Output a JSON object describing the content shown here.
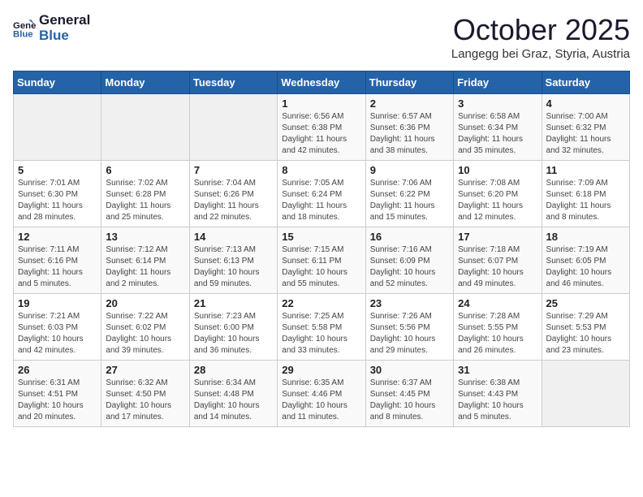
{
  "header": {
    "logo_line1": "General",
    "logo_line2": "Blue",
    "month": "October 2025",
    "location": "Langegg bei Graz, Styria, Austria"
  },
  "weekdays": [
    "Sunday",
    "Monday",
    "Tuesday",
    "Wednesday",
    "Thursday",
    "Friday",
    "Saturday"
  ],
  "weeks": [
    [
      {
        "day": "",
        "info": ""
      },
      {
        "day": "",
        "info": ""
      },
      {
        "day": "",
        "info": ""
      },
      {
        "day": "1",
        "info": "Sunrise: 6:56 AM\nSunset: 6:38 PM\nDaylight: 11 hours\nand 42 minutes."
      },
      {
        "day": "2",
        "info": "Sunrise: 6:57 AM\nSunset: 6:36 PM\nDaylight: 11 hours\nand 38 minutes."
      },
      {
        "day": "3",
        "info": "Sunrise: 6:58 AM\nSunset: 6:34 PM\nDaylight: 11 hours\nand 35 minutes."
      },
      {
        "day": "4",
        "info": "Sunrise: 7:00 AM\nSunset: 6:32 PM\nDaylight: 11 hours\nand 32 minutes."
      }
    ],
    [
      {
        "day": "5",
        "info": "Sunrise: 7:01 AM\nSunset: 6:30 PM\nDaylight: 11 hours\nand 28 minutes."
      },
      {
        "day": "6",
        "info": "Sunrise: 7:02 AM\nSunset: 6:28 PM\nDaylight: 11 hours\nand 25 minutes."
      },
      {
        "day": "7",
        "info": "Sunrise: 7:04 AM\nSunset: 6:26 PM\nDaylight: 11 hours\nand 22 minutes."
      },
      {
        "day": "8",
        "info": "Sunrise: 7:05 AM\nSunset: 6:24 PM\nDaylight: 11 hours\nand 18 minutes."
      },
      {
        "day": "9",
        "info": "Sunrise: 7:06 AM\nSunset: 6:22 PM\nDaylight: 11 hours\nand 15 minutes."
      },
      {
        "day": "10",
        "info": "Sunrise: 7:08 AM\nSunset: 6:20 PM\nDaylight: 11 hours\nand 12 minutes."
      },
      {
        "day": "11",
        "info": "Sunrise: 7:09 AM\nSunset: 6:18 PM\nDaylight: 11 hours\nand 8 minutes."
      }
    ],
    [
      {
        "day": "12",
        "info": "Sunrise: 7:11 AM\nSunset: 6:16 PM\nDaylight: 11 hours\nand 5 minutes."
      },
      {
        "day": "13",
        "info": "Sunrise: 7:12 AM\nSunset: 6:14 PM\nDaylight: 11 hours\nand 2 minutes."
      },
      {
        "day": "14",
        "info": "Sunrise: 7:13 AM\nSunset: 6:13 PM\nDaylight: 10 hours\nand 59 minutes."
      },
      {
        "day": "15",
        "info": "Sunrise: 7:15 AM\nSunset: 6:11 PM\nDaylight: 10 hours\nand 55 minutes."
      },
      {
        "day": "16",
        "info": "Sunrise: 7:16 AM\nSunset: 6:09 PM\nDaylight: 10 hours\nand 52 minutes."
      },
      {
        "day": "17",
        "info": "Sunrise: 7:18 AM\nSunset: 6:07 PM\nDaylight: 10 hours\nand 49 minutes."
      },
      {
        "day": "18",
        "info": "Sunrise: 7:19 AM\nSunset: 6:05 PM\nDaylight: 10 hours\nand 46 minutes."
      }
    ],
    [
      {
        "day": "19",
        "info": "Sunrise: 7:21 AM\nSunset: 6:03 PM\nDaylight: 10 hours\nand 42 minutes."
      },
      {
        "day": "20",
        "info": "Sunrise: 7:22 AM\nSunset: 6:02 PM\nDaylight: 10 hours\nand 39 minutes."
      },
      {
        "day": "21",
        "info": "Sunrise: 7:23 AM\nSunset: 6:00 PM\nDaylight: 10 hours\nand 36 minutes."
      },
      {
        "day": "22",
        "info": "Sunrise: 7:25 AM\nSunset: 5:58 PM\nDaylight: 10 hours\nand 33 minutes."
      },
      {
        "day": "23",
        "info": "Sunrise: 7:26 AM\nSunset: 5:56 PM\nDaylight: 10 hours\nand 29 minutes."
      },
      {
        "day": "24",
        "info": "Sunrise: 7:28 AM\nSunset: 5:55 PM\nDaylight: 10 hours\nand 26 minutes."
      },
      {
        "day": "25",
        "info": "Sunrise: 7:29 AM\nSunset: 5:53 PM\nDaylight: 10 hours\nand 23 minutes."
      }
    ],
    [
      {
        "day": "26",
        "info": "Sunrise: 6:31 AM\nSunset: 4:51 PM\nDaylight: 10 hours\nand 20 minutes."
      },
      {
        "day": "27",
        "info": "Sunrise: 6:32 AM\nSunset: 4:50 PM\nDaylight: 10 hours\nand 17 minutes."
      },
      {
        "day": "28",
        "info": "Sunrise: 6:34 AM\nSunset: 4:48 PM\nDaylight: 10 hours\nand 14 minutes."
      },
      {
        "day": "29",
        "info": "Sunrise: 6:35 AM\nSunset: 4:46 PM\nDaylight: 10 hours\nand 11 minutes."
      },
      {
        "day": "30",
        "info": "Sunrise: 6:37 AM\nSunset: 4:45 PM\nDaylight: 10 hours\nand 8 minutes."
      },
      {
        "day": "31",
        "info": "Sunrise: 6:38 AM\nSunset: 4:43 PM\nDaylight: 10 hours\nand 5 minutes."
      },
      {
        "day": "",
        "info": ""
      }
    ]
  ]
}
